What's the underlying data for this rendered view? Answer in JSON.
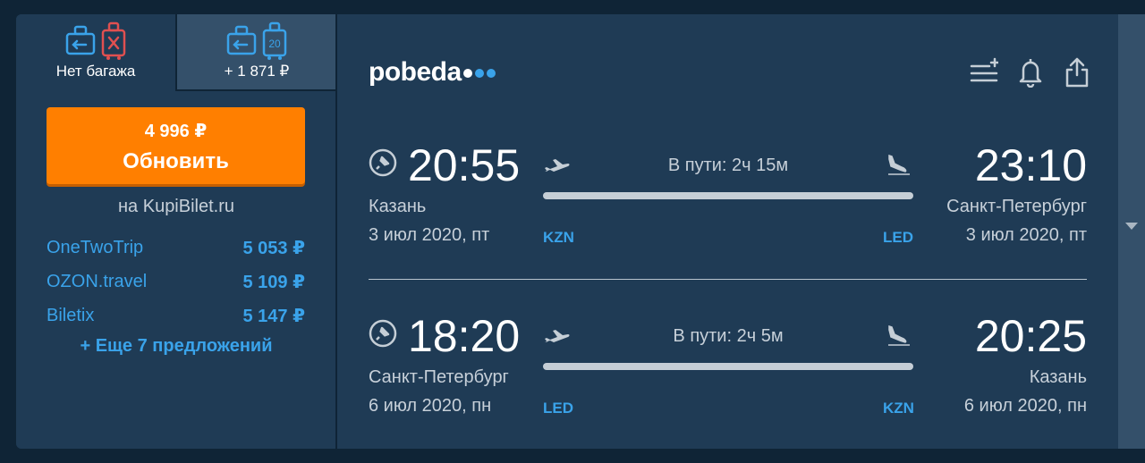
{
  "baggage_tabs": [
    {
      "label": "Нет багажа",
      "icons": [
        "hand-luggage-icon",
        "no-baggage-icon"
      ]
    },
    {
      "label": "+ 1 871 ₽",
      "icons": [
        "hand-luggage-icon",
        "baggage-20kg-icon"
      ],
      "baggage_weight": "20"
    }
  ],
  "update": {
    "price": "4 996 ₽",
    "label": "Обновить"
  },
  "provider": "на KupiBilet.ru",
  "offers": [
    {
      "name": "OneTwoTrip",
      "price": "5 053 ₽"
    },
    {
      "name": "OZON.travel",
      "price": "5 109 ₽"
    },
    {
      "name": "Biletix",
      "price": "5 147 ₽"
    }
  ],
  "more_offers": "+ Еще 7 предложений",
  "airline": {
    "name": "pobeda",
    "dot_colors": [
      "#ffffff",
      "#3aa3ea",
      "#3aa3ea"
    ]
  },
  "tools": [
    "add-filter-icon",
    "bell-icon",
    "share-icon"
  ],
  "flights": [
    {
      "dep_time": "20:55",
      "arr_time": "23:10",
      "dep_city": "Казань",
      "arr_city": "Санкт-Петербург",
      "dep_date": "3 июл 2020, пт",
      "arr_date": "3 июл 2020, пт",
      "duration": "В пути: 2ч 15м",
      "dep_code": "KZN",
      "arr_code": "LED"
    },
    {
      "dep_time": "18:20",
      "arr_time": "20:25",
      "dep_city": "Санкт-Петербург",
      "arr_city": "Казань",
      "dep_date": "6 июл 2020, пн",
      "arr_date": "6 июл 2020, пн",
      "duration": "В пути: 2ч 5м",
      "dep_code": "LED",
      "arr_code": "KZN"
    }
  ],
  "colors": {
    "accent": "#ff7f00",
    "link": "#3aa3ea",
    "panel": "#1f3b55",
    "background": "#0f2436"
  }
}
